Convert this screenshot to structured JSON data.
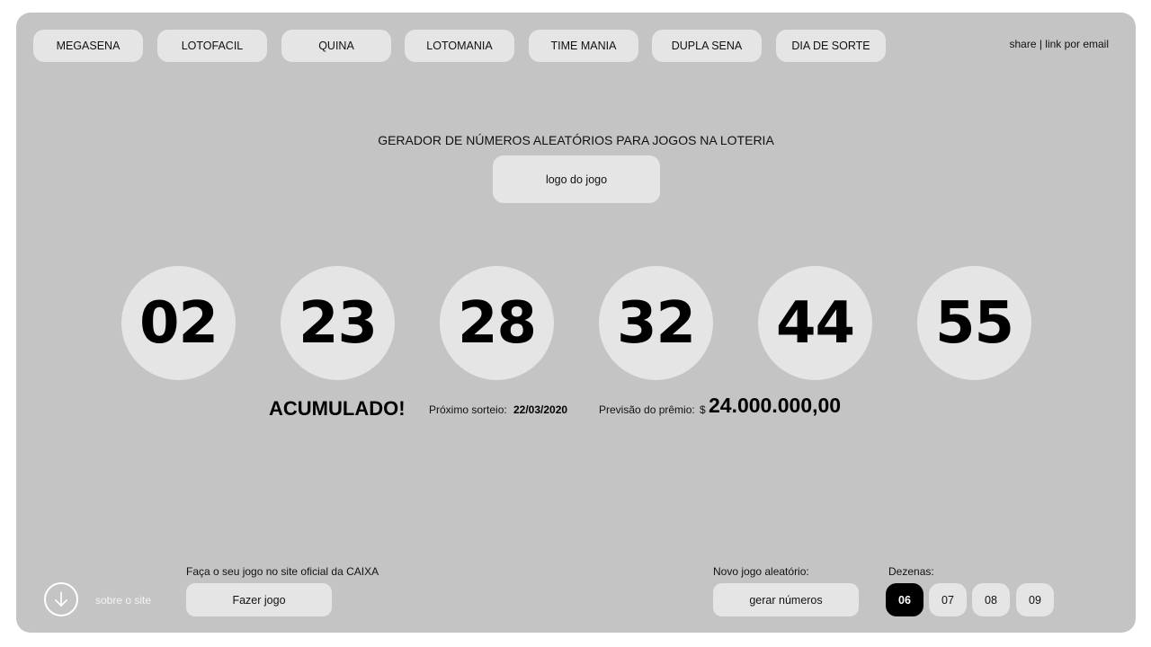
{
  "nav": {
    "items": [
      {
        "label": "MEGASENA"
      },
      {
        "label": "LOTOFACIL"
      },
      {
        "label": "QUINA"
      },
      {
        "label": "LOTOMANIA"
      },
      {
        "label": "TIME MANIA"
      },
      {
        "label": "DUPLA SENA"
      },
      {
        "label": "DIA DE SORTE"
      }
    ],
    "share_label": "share | link por email"
  },
  "header": {
    "title": "GERADOR DE NÚMEROS ALEATÓRIOS PARA JOGOS NA LOTERIA",
    "logo_label": "logo do jogo"
  },
  "draw": {
    "numbers": [
      "02",
      "23",
      "28",
      "32",
      "44",
      "55"
    ],
    "status": "ACUMULADO!",
    "next_draw_label": "Próximo sorteio:",
    "next_draw_date": "22/03/2020",
    "prize_label": "Previsão do prêmio:",
    "prize_currency": "$",
    "prize_value": "24.000.000,00"
  },
  "footer": {
    "about_icon": "arrow-down-circle-icon",
    "about_label": "sobre o site",
    "caixa_label": "Faça o seu jogo no site oficial da CAIXA",
    "caixa_button": "Fazer jogo",
    "random_label": "Novo jogo aleatório:",
    "random_button": "gerar números",
    "dezenas_label": "Dezenas:",
    "dezenas_options": [
      "06",
      "07",
      "08",
      "09"
    ],
    "dezenas_selected": "06"
  },
  "colors": {
    "background": "#c4c4c4",
    "surface": "#e5e5e5",
    "selected": "#000000"
  }
}
